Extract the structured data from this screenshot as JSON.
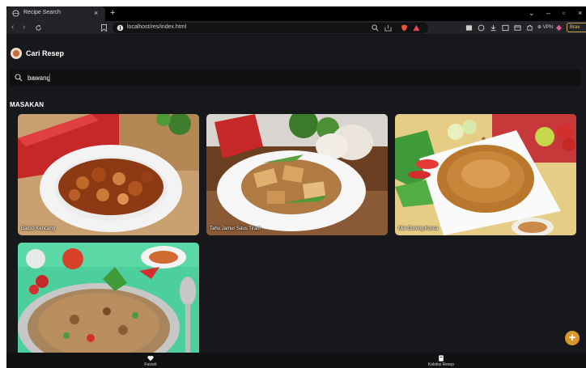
{
  "browser": {
    "tab_title": "Recipe Search",
    "url": "localhost/res/index.html",
    "vpn_label": "⊕ VPN",
    "leo_label": "Brav"
  },
  "app": {
    "title": "Cari Resep"
  },
  "search": {
    "value": "bawang"
  },
  "section": {
    "title": "MASAKAN"
  },
  "recipes": [
    {
      "name": "Bakso Kencang"
    },
    {
      "name": "Tahu Jamur Saus Tiram"
    },
    {
      "name": "Mie Goreng Korea"
    },
    {
      "name": ""
    }
  ],
  "bottom_nav": {
    "favorites_label": "Favorit",
    "collection_label": "Koleksi Resep"
  },
  "colors": {
    "accent": "#d9972b",
    "background": "#17181b"
  }
}
